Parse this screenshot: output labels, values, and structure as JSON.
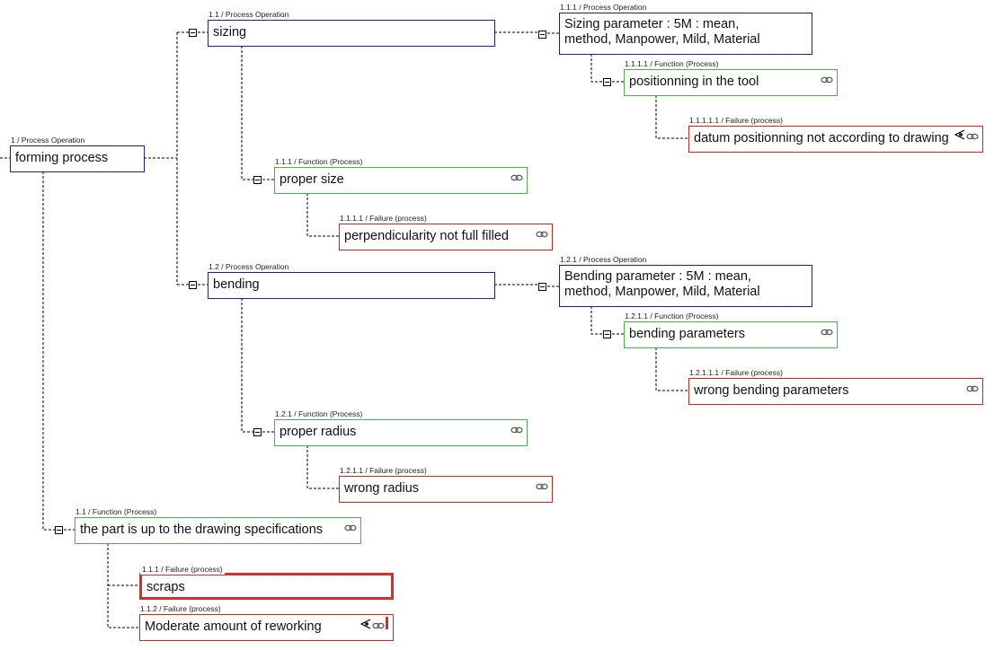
{
  "colors": {
    "process_operation": "#1a237e",
    "function": "#4caf50",
    "failure": "#c62828"
  },
  "nodes": [
    {
      "id": "1",
      "label": "1 / Process Operation",
      "text": "forming process",
      "kind": "op",
      "icons": []
    },
    {
      "id": "1.1",
      "label": "1.1 / Process Operation",
      "text": "sizing",
      "kind": "op",
      "icons": []
    },
    {
      "id": "1.1.1-op",
      "label": "1.1.1 / Process Operation",
      "text": "Sizing parameter : 5M : mean, method, Manpower, Mild, Material",
      "kind": "op",
      "icons": []
    },
    {
      "id": "1.1.1.1-fn",
      "label": "1.1.1.1 / Function (Process)",
      "text": "positionning in the tool",
      "kind": "fn",
      "icons": [
        "link-icon"
      ]
    },
    {
      "id": "1.1.1.1.1-fail",
      "label": "1.1.1.1.1 / Failure (process)",
      "text": "datum positionning not according to drawing",
      "kind": "fail",
      "icons": [
        "eye-triangle-icon",
        "link-icon"
      ]
    },
    {
      "id": "1.1.1-fn",
      "label": "1.1.1 / Function (Process)",
      "text": "proper size",
      "kind": "fn",
      "icons": [
        "link-icon"
      ]
    },
    {
      "id": "1.1.1.1-fail",
      "label": "1.1.1.1 / Failure (process)",
      "text": "perpendicularity not full filled",
      "kind": "fail",
      "icons": [
        "link-icon"
      ]
    },
    {
      "id": "1.2",
      "label": "1.2 / Process Operation",
      "text": "bending",
      "kind": "op",
      "icons": []
    },
    {
      "id": "1.2.1-op",
      "label": "1.2.1 / Process Operation",
      "text": "Bending parameter : 5M : mean, method, Manpower, Mild, Material",
      "kind": "op",
      "icons": []
    },
    {
      "id": "1.2.1.1-fn",
      "label": "1.2.1.1 / Function (Process)",
      "text": "bending parameters",
      "kind": "fn",
      "icons": [
        "link-icon"
      ]
    },
    {
      "id": "1.2.1.1.1-fail",
      "label": "1.2.1.1.1 / Failure (process)",
      "text": "wrong bending parameters",
      "kind": "fail",
      "icons": [
        "link-icon"
      ]
    },
    {
      "id": "1.2.1-fn",
      "label": "1.2.1 / Function (Process)",
      "text": "proper radius",
      "kind": "fn",
      "icons": [
        "link-icon"
      ]
    },
    {
      "id": "1.2.1.1-fail",
      "label": "1.2.1.1 / Failure (process)",
      "text": "wrong radius",
      "kind": "fail",
      "icons": [
        "link-icon"
      ]
    },
    {
      "id": "1.1-fn",
      "label": "1.1 / Function (Process)",
      "text": "the part is up to the drawing specifications",
      "kind": "fn",
      "icons": [
        "link-icon"
      ]
    },
    {
      "id": "1.1.1-fail",
      "label": "1.1.1 / Failure (process)",
      "text": "scraps",
      "kind": "fail",
      "selected": true,
      "icons": []
    },
    {
      "id": "1.1.2-fail",
      "label": "1.1.2 / Failure (process)",
      "text": "Moderate amount of reworking",
      "kind": "fail",
      "icons": [
        "eye-triangle-icon",
        "link-icon",
        "warning-flag-icon"
      ]
    }
  ]
}
